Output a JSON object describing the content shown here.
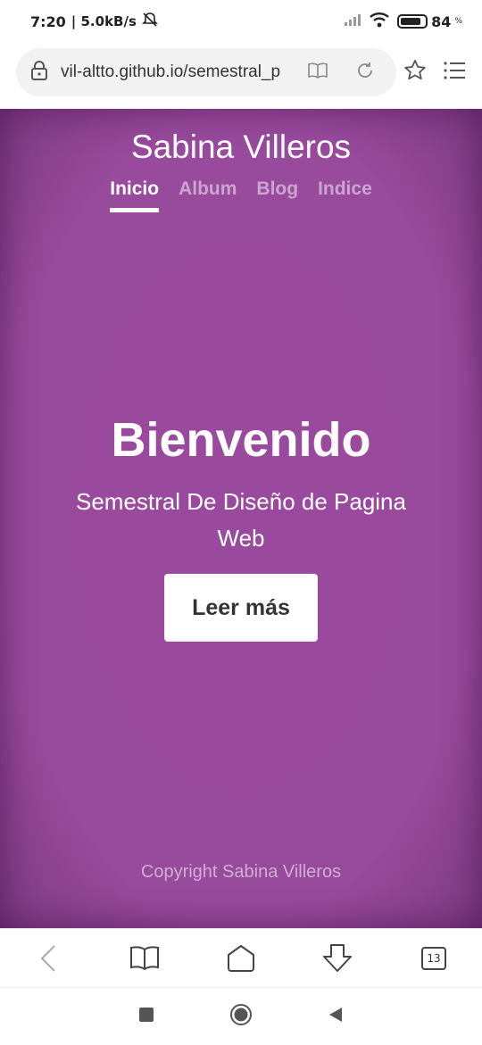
{
  "status": {
    "time": "7:20",
    "speed": "| 5.0kB/s",
    "battery": "84",
    "battery_unit": "%",
    "battery_level": 0.84
  },
  "browser": {
    "url": "vil-altto.github.io/semestral_p",
    "tabs_count": "13"
  },
  "site": {
    "title": "Sabina Villeros",
    "nav": [
      {
        "label": "Inicio",
        "active": true
      },
      {
        "label": "Album",
        "active": false
      },
      {
        "label": "Blog",
        "active": false
      },
      {
        "label": "Indice",
        "active": false
      }
    ],
    "hero": {
      "title": "Bienvenido",
      "subtitle": "Semestral De Diseño de Pagina Web",
      "button": "Leer más"
    },
    "footer": "Copyright Sabina Villeros"
  },
  "colors": {
    "page_bg": "#984a9c",
    "text": "#ffffff"
  },
  "icons": {
    "status": [
      "notifications-off-icon",
      "signal-icon",
      "wifi-icon",
      "battery-icon"
    ],
    "browser_bar": [
      "lock-icon",
      "reader-mode-icon",
      "reload-icon",
      "star-icon",
      "menu-icon"
    ],
    "toolbar": [
      "back-icon",
      "bookmarks-icon",
      "home-icon",
      "download-icon",
      "tabs-icon"
    ],
    "android": [
      "recents-icon",
      "home-circle-icon",
      "back-triangle-icon"
    ]
  }
}
